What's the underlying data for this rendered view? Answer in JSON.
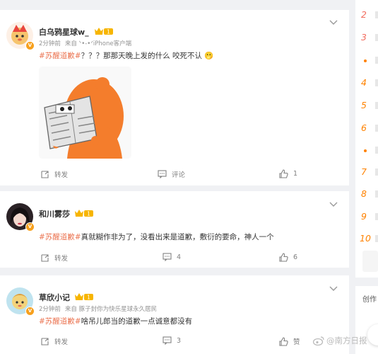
{
  "posts": [
    {
      "username": "白乌鸦星球w_",
      "badge_level": "1",
      "time": "2分钟前",
      "source": "来自 ᐠ•-•ᐟiPhone客户端",
      "topic": "#苏醒道歉#",
      "text": "？？？那那天晚上发的什么 咬死不认",
      "emoji": "🫢",
      "actions": {
        "repost": "转发",
        "comment": "评论",
        "like": "1"
      }
    },
    {
      "username": "和川雾莎",
      "badge_level": "1",
      "time": "",
      "source": "",
      "topic": "#苏醒道歉#",
      "text": "真就糊作非为了，没看出来是道歉，敷衍的要命，神人一个",
      "actions": {
        "repost": "转发",
        "comment": "4",
        "like": "6"
      }
    },
    {
      "username": "草欣小记",
      "badge_level": "1",
      "time": "2分钟前",
      "source": "来自 豚子封你为快乐星球永久居民",
      "topic": "#苏醒道歉#",
      "text": "啥吊儿郎当的道歉一点诚意都没有",
      "actions": {
        "repost": "转发",
        "comment": "3",
        "like": "赞"
      }
    }
  ],
  "sidebar": {
    "ranks": [
      "2",
      "3",
      "",
      "4",
      "5",
      "6",
      "",
      "7",
      "8",
      "9",
      "10"
    ],
    "card2_title": "创作"
  },
  "watermark": "@南方日报",
  "colors": {
    "topic": "#eb7350",
    "rank_hot": "#f26d5f",
    "rank_normal": "#ff8200",
    "badge": "#f7b500"
  }
}
